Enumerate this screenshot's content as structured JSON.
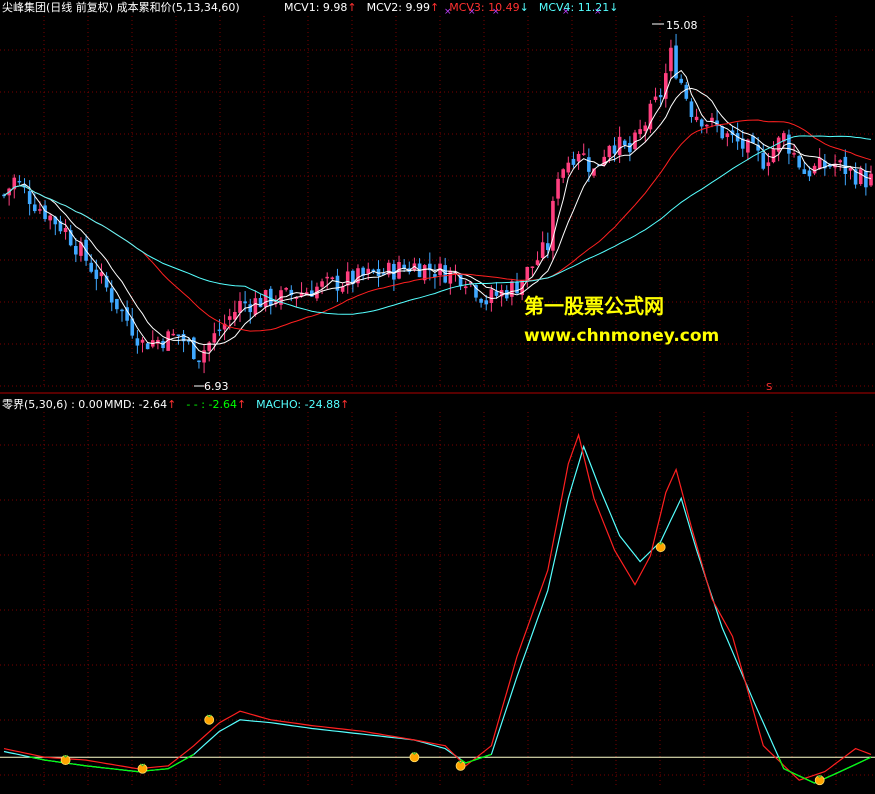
{
  "upper_panel": {
    "title": "尖峰集团(日线 前复权) 成本累和价(5,13,34,60)",
    "legend": [
      {
        "label": "MCV1: 9.98",
        "arrow": "↑",
        "color": "#ffffff",
        "arrow_color": "#ff3030"
      },
      {
        "label": "MCV2: 9.99",
        "arrow": "↑",
        "color": "#ffffff",
        "arrow_color": "#ff3030"
      },
      {
        "label": "MCV3: 10.49",
        "arrow": "↓",
        "color": "#ff3030",
        "arrow_color": "#55ffff"
      },
      {
        "label": "MCV4: 11.21",
        "arrow": "↓",
        "color": "#55ffff",
        "arrow_color": "#55ffff"
      }
    ],
    "high_label": "15.08",
    "low_label": "6.93",
    "signal_label": "S"
  },
  "lower_panel": {
    "title": "零界(5,30,6) : 0.00",
    "legend": [
      {
        "label": "MMD: -2.64",
        "arrow": "↑",
        "color": "#ffffff",
        "arrow_color": "#ff3030"
      },
      {
        "label": "- - : -2.64",
        "arrow": "↑",
        "color": "#00ff00",
        "arrow_color": "#ff3030"
      },
      {
        "label": "MACHO: -24.88",
        "arrow": "↑",
        "color": "#55ffff",
        "arrow_color": "#ff3030"
      }
    ]
  },
  "watermark": {
    "line1": "第一股票公式网",
    "line2": "www.chnmoney.com"
  },
  "colors": {
    "up": "#ff3f7f",
    "down": "#3fa8ff",
    "grid": "#7a0000",
    "mcv1": "#ffffff",
    "mcv3": "#ff2020",
    "mcv4": "#55ffff",
    "zero_line": "#ffffcc",
    "marker": "#ffa400"
  },
  "chart_data": [
    {
      "type": "candlestick",
      "title": "尖峰集团(日线 前复权) 成本累和价(5,13,34,60)",
      "y_range": [
        6.5,
        16.0
      ],
      "bars": 170,
      "price_path": [
        [
          0,
          11.4
        ],
        [
          2,
          11.8
        ],
        [
          6,
          11.2
        ],
        [
          12,
          10.5
        ],
        [
          20,
          9.0
        ],
        [
          27,
          7.6
        ],
        [
          34,
          7.8
        ],
        [
          38,
          7.3
        ],
        [
          40,
          7.6
        ],
        [
          46,
          8.6
        ],
        [
          55,
          8.8
        ],
        [
          60,
          9.0
        ],
        [
          70,
          9.3
        ],
        [
          80,
          9.6
        ],
        [
          90,
          9.3
        ],
        [
          94,
          8.7
        ],
        [
          100,
          9.1
        ],
        [
          106,
          10.1
        ],
        [
          108,
          12.0
        ],
        [
          112,
          12.6
        ],
        [
          115,
          12.0
        ],
        [
          118,
          12.8
        ],
        [
          122,
          12.5
        ],
        [
          128,
          14.0
        ],
        [
          130,
          15.0
        ],
        [
          134,
          13.6
        ],
        [
          140,
          13.0
        ],
        [
          148,
          12.3
        ],
        [
          152,
          12.9
        ],
        [
          156,
          12.0
        ],
        [
          162,
          12.2
        ],
        [
          168,
          11.8
        ]
      ],
      "series": [
        {
          "name": "MCV1",
          "last": 9.98
        },
        {
          "name": "MCV2",
          "last": 9.99
        },
        {
          "name": "MCV3",
          "last": 10.49
        },
        {
          "name": "MCV4",
          "last": 11.21
        }
      ],
      "annotations": [
        {
          "bar": 130,
          "value": 15.08
        },
        {
          "bar": 38,
          "value": 6.93
        }
      ]
    },
    {
      "type": "line",
      "title": "零界(5,30,6) : 0.00",
      "y_range": [
        -10,
        120
      ],
      "series": [
        {
          "name": "MMD",
          "last": -2.64,
          "points": [
            [
              0,
              3
            ],
            [
              8,
              0
            ],
            [
              16,
              -1
            ],
            [
              26,
              -4
            ],
            [
              32,
              -3
            ],
            [
              37,
              4
            ],
            [
              42,
              12
            ],
            [
              46,
              16
            ],
            [
              52,
              13
            ],
            [
              60,
              11
            ],
            [
              70,
              9
            ],
            [
              80,
              6
            ],
            [
              86,
              4
            ],
            [
              90,
              -3
            ],
            [
              95,
              4
            ],
            [
              100,
              35
            ],
            [
              106,
              65
            ],
            [
              110,
              102
            ],
            [
              112,
              112
            ],
            [
              115,
              90
            ],
            [
              119,
              72
            ],
            [
              123,
              60
            ],
            [
              126,
              70
            ],
            [
              129,
              92
            ],
            [
              131,
              100
            ],
            [
              134,
              80
            ],
            [
              138,
              55
            ],
            [
              142,
              42
            ],
            [
              148,
              4
            ],
            [
              155,
              -8
            ],
            [
              160,
              -5
            ],
            [
              166,
              3
            ],
            [
              169,
              1
            ]
          ]
        },
        {
          "name": "- -",
          "last": -2.64
        },
        {
          "name": "MACHO",
          "last": -24.88,
          "points": [
            [
              0,
              2
            ],
            [
              8,
              -1
            ],
            [
              16,
              -3
            ],
            [
              26,
              -5
            ],
            [
              32,
              -4
            ],
            [
              37,
              1
            ],
            [
              42,
              9
            ],
            [
              46,
              13
            ],
            [
              52,
              12
            ],
            [
              60,
              10
            ],
            [
              70,
              8
            ],
            [
              80,
              6
            ],
            [
              86,
              3
            ],
            [
              90,
              -2
            ],
            [
              95,
              1
            ],
            [
              100,
              28
            ],
            [
              106,
              58
            ],
            [
              110,
              90
            ],
            [
              113,
              108
            ],
            [
              116,
              94
            ],
            [
              120,
              77
            ],
            [
              124,
              68
            ],
            [
              128,
              75
            ],
            [
              132,
              90
            ],
            [
              135,
              72
            ],
            [
              140,
              45
            ],
            [
              146,
              20
            ],
            [
              152,
              -4
            ],
            [
              158,
              -9
            ],
            [
              163,
              -5
            ],
            [
              169,
              0
            ]
          ]
        }
      ],
      "markers": [
        {
          "bar": 12,
          "value": -1
        },
        {
          "bar": 27,
          "value": -4
        },
        {
          "bar": 40,
          "value": 13
        },
        {
          "bar": 80,
          "value": 0
        },
        {
          "bar": 89,
          "value": -3
        },
        {
          "bar": 128,
          "value": 73
        },
        {
          "bar": 159,
          "value": -8
        }
      ]
    }
  ]
}
